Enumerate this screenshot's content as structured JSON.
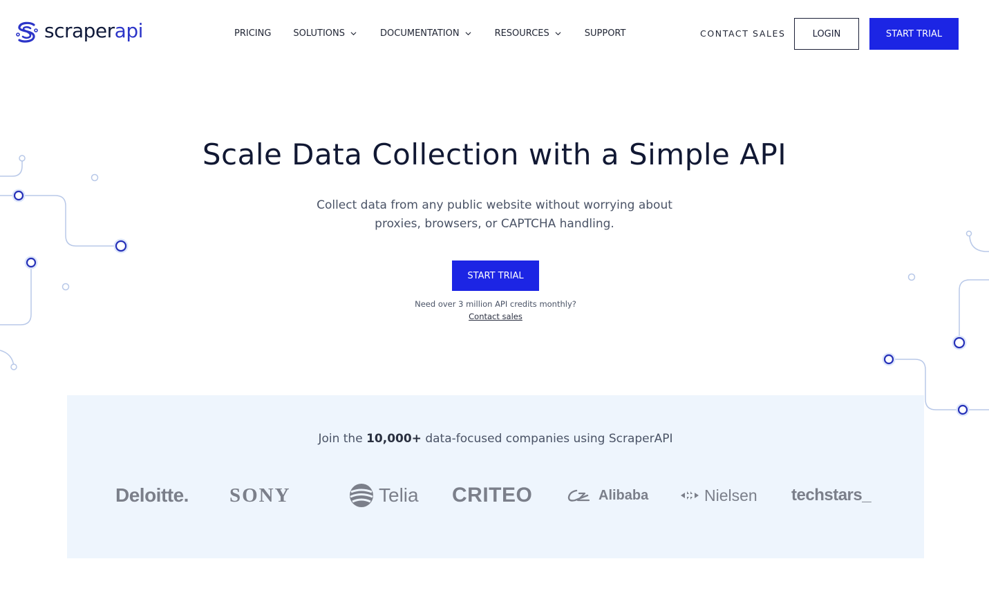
{
  "brand": {
    "name_part1": "scraper",
    "name_part2": "api",
    "primary_color": "#1c25e4",
    "text_color": "#101a3a"
  },
  "nav": {
    "items": [
      {
        "label": "PRICING",
        "has_dropdown": false
      },
      {
        "label": "SOLUTIONS",
        "has_dropdown": true
      },
      {
        "label": "DOCUMENTATION",
        "has_dropdown": true
      },
      {
        "label": "RESOURCES",
        "has_dropdown": true
      },
      {
        "label": "SUPPORT",
        "has_dropdown": false
      }
    ],
    "contact_sales": "CONTACT SALES",
    "login": "LOGIN",
    "start_trial": "START TRIAL"
  },
  "hero": {
    "title": "Scale Data Collection with a Simple API",
    "subtitle_line1": "Collect data from any public website without worrying about",
    "subtitle_line2": "proxies, browsers, or CAPTCHA handling.",
    "cta": "START TRIAL",
    "note": "Need over 3 million API credits monthly?",
    "note_link": "Contact sales"
  },
  "trust": {
    "prefix": "Join the ",
    "highlight": "10,000+",
    "suffix": " data-focused companies using ScraperAPI",
    "background_color": "#eef5fd",
    "logos": [
      "Deloitte.",
      "SONY",
      "Telia",
      "CRITEO",
      "Alibaba",
      "Nielsen",
      "techstars_"
    ]
  },
  "icons": {
    "logo_mark": "scraperapi-s-logo-icon",
    "chevron": "chevron-down-icon"
  }
}
